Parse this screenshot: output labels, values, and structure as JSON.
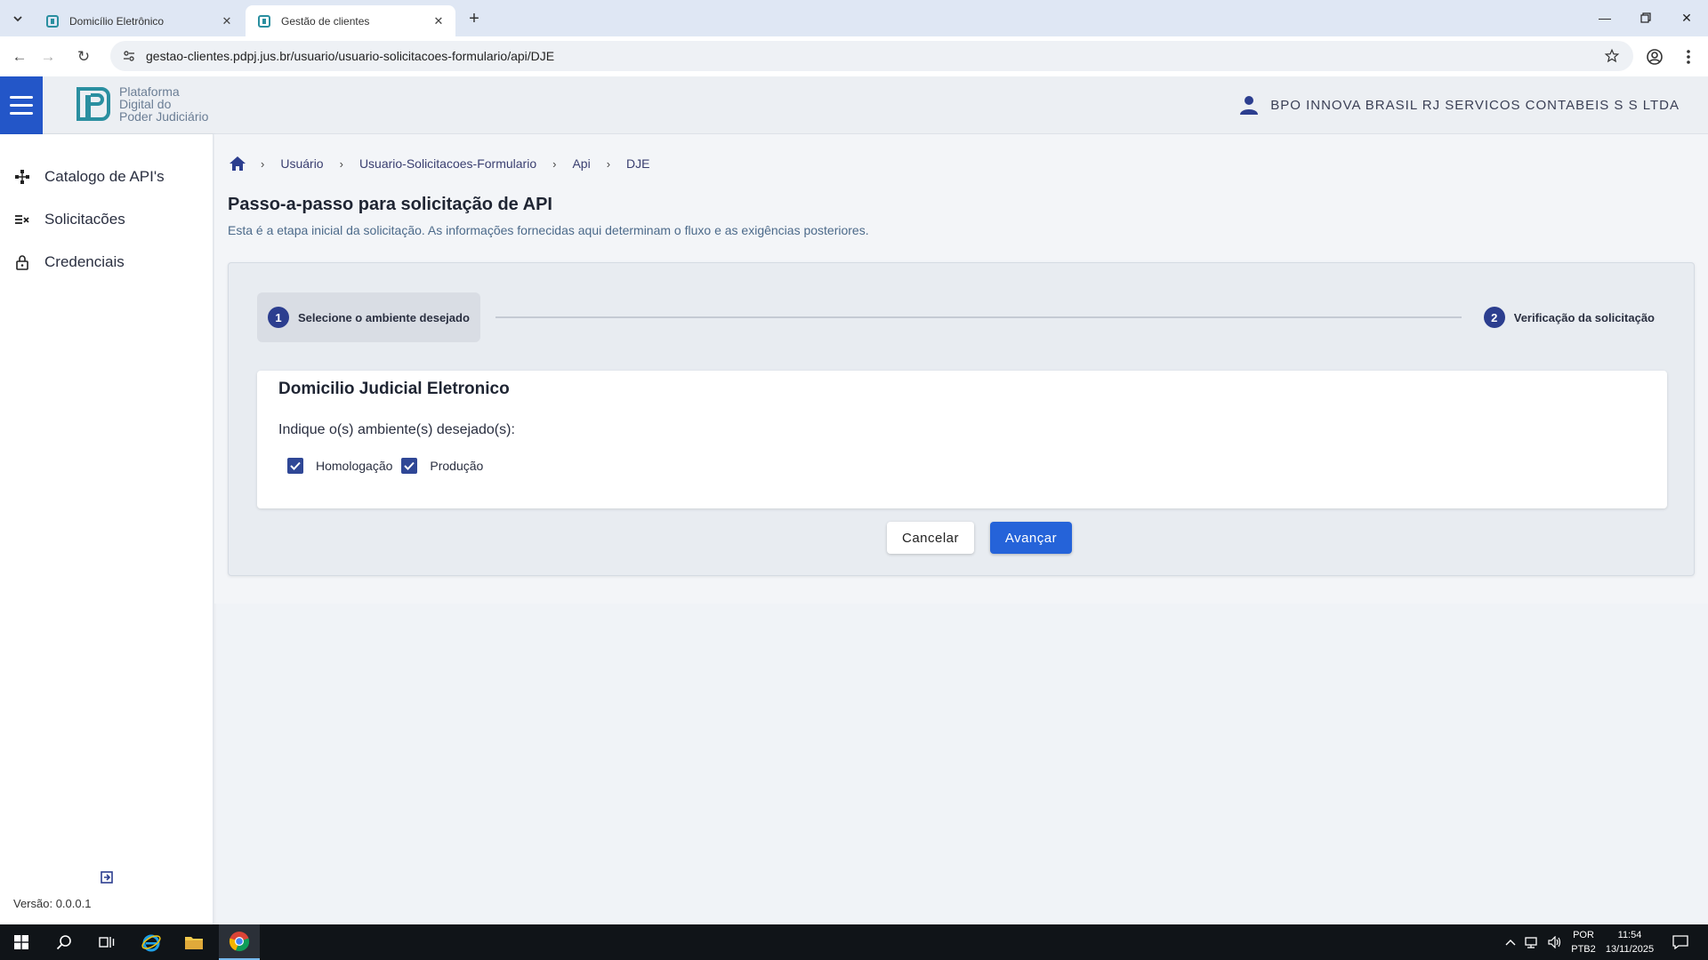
{
  "browser": {
    "tabs": [
      {
        "title": "Domicílio Eletrônico",
        "active": false
      },
      {
        "title": "Gestão de clientes",
        "active": true
      }
    ],
    "url": "gestao-clientes.pdpj.jus.br/usuario/usuario-solicitacoes-formulario/api/DJE"
  },
  "header": {
    "logo_lines": [
      "Plataforma",
      "Digital do",
      "Poder Judiciário"
    ],
    "user_name": "BPO INNOVA BRASIL RJ SERVICOS CONTABEIS S S LTDA"
  },
  "sidebar": {
    "items": [
      {
        "label": "Catalogo de API's",
        "icon": "api-catalog-icon"
      },
      {
        "label": "Solicitacões",
        "icon": "requests-list-icon"
      },
      {
        "label": "Credenciais",
        "icon": "lock-icon"
      }
    ],
    "version": "Versão: 0.0.0.1"
  },
  "breadcrumb": [
    "Usuário",
    "Usuario-Solicitacoes-Formulario",
    "Api",
    "DJE"
  ],
  "page": {
    "title": "Passo-a-passo para solicitação de API",
    "subtitle": "Esta é a etapa inicial da solicitação. As informações fornecidas aqui determinam o fluxo e as exigências posteriores."
  },
  "wizard": {
    "steps": [
      {
        "num": "1",
        "label": "Selecione o ambiente desejado",
        "active": true
      },
      {
        "num": "2",
        "label": "Verificação da solicitação",
        "active": false
      }
    ],
    "card_title": "Domicilio Judicial Eletronico",
    "question": "Indique o(s) ambiente(s) desejado(s):",
    "options": [
      {
        "label": "Homologação",
        "checked": true
      },
      {
        "label": "Produção",
        "checked": true
      }
    ],
    "cancel_label": "Cancelar",
    "next_label": "Avançar"
  },
  "taskbar": {
    "lang_line1": "POR",
    "lang_line2": "PTB2",
    "time": "11:54",
    "date": "13/11/2025"
  },
  "colors": {
    "primary": "#2563d9",
    "hamburger": "#2356c8",
    "step_badge": "#2c3e8f"
  }
}
